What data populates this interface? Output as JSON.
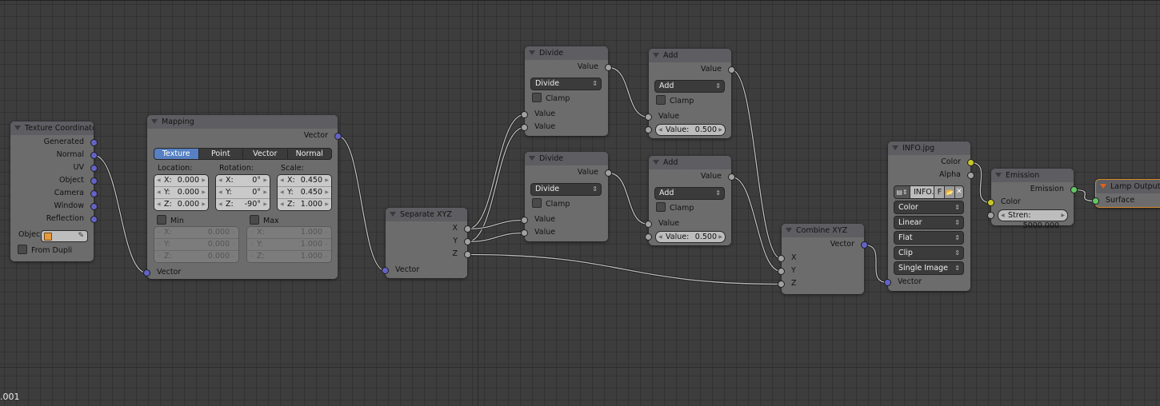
{
  "editor": {
    "footer_label": ".001"
  },
  "socket_colors": {
    "vector": "#6363c7",
    "float": "#a1a1a1",
    "color": "#c7c729",
    "shader": "#63c763"
  },
  "accent_color": "#5680c2",
  "output_border_color": "#d9892e",
  "nodes": [
    {
      "id": "texcoord",
      "title": "Texture Coordinate",
      "rows": [
        {
          "t": "out",
          "label": "Generated",
          "s": "vector"
        },
        {
          "t": "out",
          "label": "Normal",
          "s": "vector"
        },
        {
          "t": "out",
          "label": "UV",
          "s": "vector"
        },
        {
          "t": "out",
          "label": "Object",
          "s": "vector"
        },
        {
          "t": "out",
          "label": "Camera",
          "s": "vector"
        },
        {
          "t": "out",
          "label": "Window",
          "s": "vector"
        },
        {
          "t": "out",
          "label": "Reflection",
          "s": "vector"
        },
        {
          "t": "obj",
          "label": "Objec",
          "icon": "cube-icon"
        },
        {
          "t": "chk",
          "label": "From Dupli",
          "checked": false
        }
      ]
    },
    {
      "id": "mapping",
      "title": "Mapping",
      "rows": [
        {
          "t": "out",
          "label": "Vector",
          "s": "vector"
        },
        {
          "t": "tabs",
          "items": [
            "Texture",
            "Point",
            "Vector",
            "Normal"
          ],
          "active": 0
        },
        {
          "t": "vec",
          "cols": [
            {
              "label": "Location:",
              "values": [
                [
                  "X:",
                  "0.000"
                ],
                [
                  "Y:",
                  "0.000"
                ],
                [
                  "Z:",
                  "0.000"
                ]
              ]
            },
            {
              "label": "Rotation:",
              "values": [
                [
                  "X:",
                  "0°"
                ],
                [
                  "Y:",
                  "0°"
                ],
                [
                  "Z:",
                  "-90°"
                ]
              ]
            },
            {
              "label": "Scale:",
              "values": [
                [
                  "X:",
                  "0.450"
                ],
                [
                  "Y:",
                  "0.450"
                ],
                [
                  "Z:",
                  "1.000"
                ]
              ]
            }
          ]
        },
        {
          "t": "mm",
          "cols": [
            {
              "label": "Min",
              "checked": false,
              "values": [
                [
                  "X:",
                  "0.000"
                ],
                [
                  "Y:",
                  "0.000"
                ],
                [
                  "Z:",
                  "0.000"
                ]
              ]
            },
            {
              "label": "Max",
              "checked": false,
              "values": [
                [
                  "X:",
                  "1.000"
                ],
                [
                  "Y:",
                  "1.000"
                ],
                [
                  "Z:",
                  "1.000"
                ]
              ]
            }
          ]
        },
        {
          "t": "in",
          "label": "Vector",
          "s": "vector"
        }
      ]
    },
    {
      "id": "sepxyz",
      "title": "Separate XYZ",
      "rows": [
        {
          "t": "out",
          "label": "X",
          "s": "float"
        },
        {
          "t": "out",
          "label": "Y",
          "s": "float"
        },
        {
          "t": "out",
          "label": "Z",
          "s": "float"
        },
        {
          "t": "in",
          "label": "Vector",
          "s": "vector"
        }
      ]
    },
    {
      "id": "divide1",
      "title": "Divide",
      "rows": [
        {
          "t": "out",
          "label": "Value",
          "s": "float"
        },
        {
          "t": "sel",
          "value": "Divide"
        },
        {
          "t": "chk",
          "label": "Clamp",
          "checked": false
        },
        {
          "t": "in",
          "label": "Value",
          "s": "float"
        },
        {
          "t": "in",
          "label": "Value",
          "s": "float"
        }
      ]
    },
    {
      "id": "divide2",
      "title": "Divide",
      "rows": [
        {
          "t": "out",
          "label": "Value",
          "s": "float"
        },
        {
          "t": "sel",
          "value": "Divide"
        },
        {
          "t": "chk",
          "label": "Clamp",
          "checked": false
        },
        {
          "t": "in",
          "label": "Value",
          "s": "float"
        },
        {
          "t": "in",
          "label": "Value",
          "s": "float"
        }
      ]
    },
    {
      "id": "add1",
      "title": "Add",
      "rows": [
        {
          "t": "out",
          "label": "Value",
          "s": "float"
        },
        {
          "t": "sel",
          "value": "Add"
        },
        {
          "t": "chk",
          "label": "Clamp",
          "checked": false
        },
        {
          "t": "in",
          "label": "Value",
          "s": "float"
        },
        {
          "t": "infield",
          "label": "Value:",
          "value": "0.500",
          "s": "float"
        }
      ]
    },
    {
      "id": "add2",
      "title": "Add",
      "rows": [
        {
          "t": "out",
          "label": "Value",
          "s": "float"
        },
        {
          "t": "sel",
          "value": "Add"
        },
        {
          "t": "chk",
          "label": "Clamp",
          "checked": false
        },
        {
          "t": "in",
          "label": "Value",
          "s": "float"
        },
        {
          "t": "infield",
          "label": "Value:",
          "value": "0.500",
          "s": "float"
        }
      ]
    },
    {
      "id": "combine",
      "title": "Combine XYZ",
      "rows": [
        {
          "t": "out",
          "label": "Vector",
          "s": "vector"
        },
        {
          "t": "in",
          "label": "X",
          "s": "float"
        },
        {
          "t": "in",
          "label": "Y",
          "s": "float"
        },
        {
          "t": "in",
          "label": "Z",
          "s": "float"
        }
      ]
    },
    {
      "id": "image",
      "title": "INFO.jpg",
      "rows": [
        {
          "t": "out",
          "label": "Color",
          "s": "color"
        },
        {
          "t": "out",
          "label": "Alpha",
          "s": "float"
        },
        {
          "t": "img",
          "name": "INFO.",
          "f": "F"
        },
        {
          "t": "sel",
          "value": "Color"
        },
        {
          "t": "sel",
          "value": "Linear"
        },
        {
          "t": "sel",
          "value": "Flat"
        },
        {
          "t": "sel",
          "value": "Clip"
        },
        {
          "t": "sel",
          "value": "Single Image"
        },
        {
          "t": "in",
          "label": "Vector",
          "s": "vector"
        }
      ]
    },
    {
      "id": "emission",
      "title": "Emission",
      "rows": [
        {
          "t": "out",
          "label": "Emission",
          "s": "shader"
        },
        {
          "t": "in",
          "label": "Color",
          "s": "color"
        },
        {
          "t": "infield",
          "label": "Stren:",
          "value": "5000.000",
          "s": "float"
        }
      ]
    },
    {
      "id": "lamp",
      "title": "Lamp Output",
      "output": true,
      "rows": [
        {
          "t": "in",
          "label": "Surface",
          "s": "shader"
        }
      ]
    }
  ],
  "links": [
    {
      "from": "texcoord.1",
      "to": "mapping.4"
    },
    {
      "from": "mapping.0",
      "to": "sepxyz.3"
    },
    {
      "from": "sepxyz.0",
      "to": "divide1.3"
    },
    {
      "from": "sepxyz.1",
      "to": "divide1.4"
    },
    {
      "from": "sepxyz.0",
      "to": "divide2.3"
    },
    {
      "from": "sepxyz.1",
      "to": "divide2.4"
    },
    {
      "from": "divide1.0",
      "to": "add1.3"
    },
    {
      "from": "divide2.0",
      "to": "add2.3"
    },
    {
      "from": "add1.0",
      "to": "combine.1"
    },
    {
      "from": "add2.0",
      "to": "combine.2"
    },
    {
      "from": "sepxyz.2",
      "to": "combine.3"
    },
    {
      "from": "combine.0",
      "to": "image.8"
    },
    {
      "from": "image.0",
      "to": "emission.1"
    },
    {
      "from": "emission.0",
      "to": "lamp.0"
    }
  ]
}
